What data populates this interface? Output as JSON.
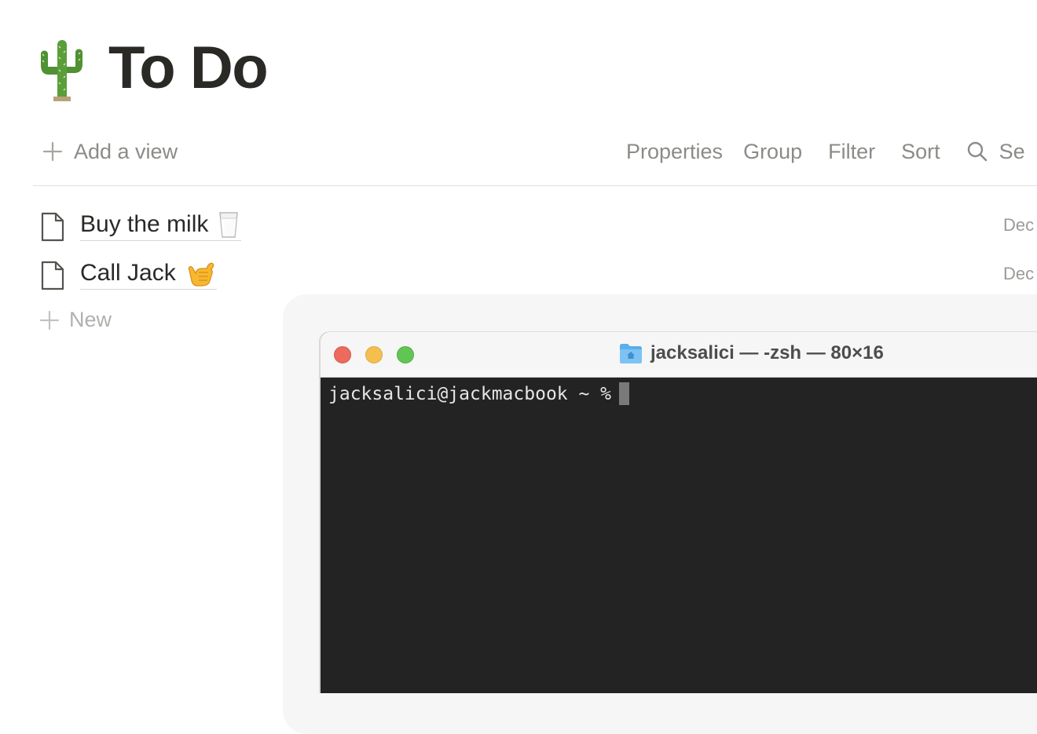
{
  "page": {
    "title": "To Do",
    "title_icon": "cactus-icon"
  },
  "toolbar": {
    "add_view": "Add a view",
    "properties": "Properties",
    "group": "Group",
    "filter": "Filter",
    "sort": "Sort",
    "search": "Se"
  },
  "tasks": [
    {
      "name": "Buy the milk",
      "emoji": "milk-glass-icon",
      "date": "Dec"
    },
    {
      "name": "Call Jack",
      "emoji": "call-me-hand-icon",
      "date": "Dec"
    }
  ],
  "new_label": "New",
  "terminal": {
    "title": "jacksalici — -zsh — 80×16",
    "prompt": "jacksalici@jackmacbook ~ %",
    "colors": {
      "close": "#ed6a5e",
      "minimize": "#f5bf4f",
      "zoom": "#61c554",
      "background": "#232323"
    }
  }
}
